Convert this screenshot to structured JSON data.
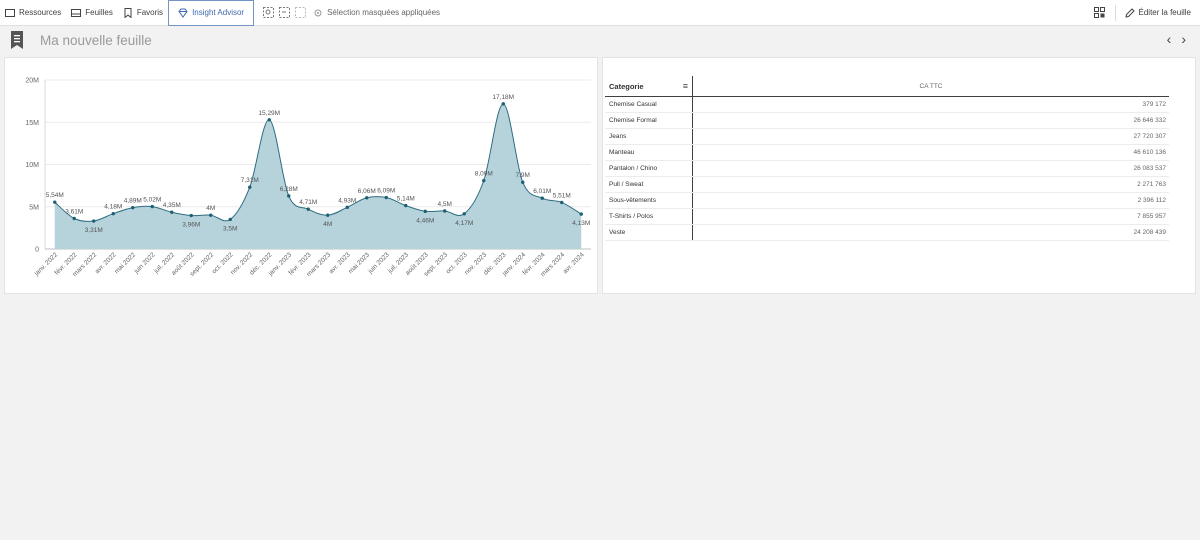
{
  "toolbar": {
    "resources": "Ressources",
    "sheets": "Feuilles",
    "favorites": "Favoris",
    "insight_advisor": "Insight Advisor",
    "selection_info": "Sélection masquées appliquées",
    "edit_sheet": "Éditer la feuille"
  },
  "sheet": {
    "title": "Ma nouvelle feuille",
    "prev": "‹",
    "next": "›"
  },
  "colors": {
    "accent": "#3f6bb0",
    "area_fill": "#b6d3dc",
    "area_stroke": "#2e6d80",
    "point": "#1d5f73"
  },
  "chart_data": {
    "type": "area",
    "x": [
      "janv. 2022",
      "févr. 2022",
      "mars 2022",
      "avr. 2022",
      "mai 2022",
      "juin 2022",
      "juil. 2022",
      "août 2022",
      "sept. 2022",
      "oct. 2022",
      "nov. 2022",
      "déc. 2022",
      "janv. 2023",
      "févr. 2023",
      "mars 2023",
      "avr. 2023",
      "mai 2023",
      "juin 2023",
      "juil. 2023",
      "août 2023",
      "sept. 2023",
      "oct. 2023",
      "nov. 2023",
      "déc. 2023",
      "janv. 2024",
      "févr. 2024",
      "mars 2024",
      "avr. 2024"
    ],
    "values": [
      5.54,
      3.61,
      3.31,
      4.18,
      4.89,
      5.02,
      4.35,
      3.96,
      4.0,
      3.5,
      7.31,
      15.29,
      6.28,
      4.71,
      4.0,
      4.93,
      6.06,
      6.09,
      5.14,
      4.46,
      4.5,
      4.17,
      8.09,
      17.18,
      7.9,
      6.01,
      5.51,
      4.13
    ],
    "labels": [
      "5,54M",
      "3,61M",
      "3,31M",
      "4,18M",
      "4,89M",
      "5,02M",
      "4,35M",
      "3,96M",
      "4M",
      "3,5M",
      "7,31M",
      "15,29M",
      "6,28M",
      "4,71M",
      "4M",
      "4,93M",
      "6,06M",
      "6,09M",
      "5,14M",
      "4,46M",
      "4,5M",
      "4,17M",
      "8,09M",
      "17,18M",
      "7,9M",
      "6,01M",
      "5,51M",
      "4,13M"
    ],
    "label_pos": [
      "above",
      "above",
      "below",
      "above",
      "above",
      "above",
      "above",
      "below",
      "above",
      "below",
      "above",
      "above",
      "above",
      "above",
      "below",
      "above",
      "above",
      "above",
      "above",
      "below",
      "above",
      "below",
      "above",
      "above",
      "above",
      "above",
      "above",
      "below"
    ],
    "y_ticks": [
      "0",
      "5M",
      "10M",
      "15M",
      "20M"
    ],
    "ylim": [
      0,
      20
    ],
    "grid": true,
    "title": "",
    "xlabel": "",
    "ylabel": ""
  },
  "table": {
    "headers": [
      "Categorie",
      "CA TTC"
    ],
    "rows": [
      {
        "cat": "Chemise Casual",
        "ca": "379 172"
      },
      {
        "cat": "Chemise Formal",
        "ca": "26 646 332"
      },
      {
        "cat": "Jeans",
        "ca": "27 720 307"
      },
      {
        "cat": "Manteau",
        "ca": "46 610 136"
      },
      {
        "cat": "Pantalon / Chino",
        "ca": "26 083 537"
      },
      {
        "cat": "Pull / Sweat",
        "ca": "2 271 763"
      },
      {
        "cat": "Sous-vêtements",
        "ca": "2 396 112"
      },
      {
        "cat": "T-Shirts / Polos",
        "ca": "7 855 957"
      },
      {
        "cat": "Veste",
        "ca": "24 208 439"
      }
    ]
  }
}
